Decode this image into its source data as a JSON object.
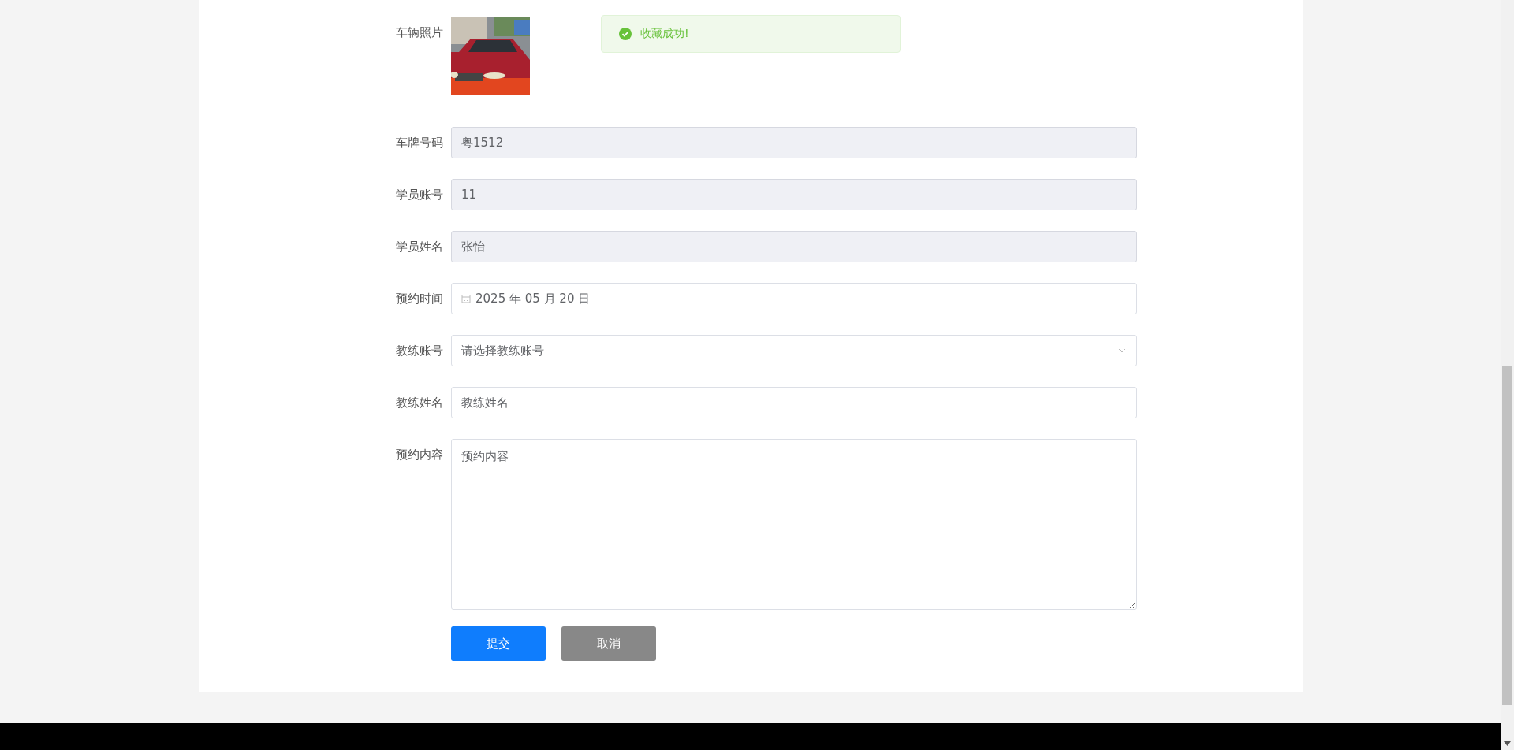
{
  "toast": {
    "kind": "success",
    "text": "收藏成功!"
  },
  "photo": {
    "label": "车辆照片",
    "kind": "picture"
  },
  "fields": [
    {
      "kind": "text",
      "label": "车牌号码",
      "value": "粤1512",
      "readonly": true
    },
    {
      "kind": "text",
      "label": "学员账号",
      "value": "11",
      "readonly": true
    },
    {
      "kind": "text",
      "label": "学员姓名",
      "value": "张怡",
      "readonly": true
    },
    {
      "kind": "date",
      "label": "预约时间",
      "value": "2025 年 05 月 20 日",
      "readonly": false
    },
    {
      "kind": "select",
      "label": "教练账号",
      "placeholder": "请选择教练账号",
      "readonly": false
    },
    {
      "kind": "text",
      "label": "教练姓名",
      "placeholder": "教练姓名",
      "readonly": false
    },
    {
      "kind": "textarea",
      "label": "预约内容",
      "placeholder": "预约内容",
      "readonly": false
    }
  ],
  "buttons": [
    {
      "kind": "primary",
      "label": "提交"
    },
    {
      "kind": "secondary",
      "label": "取消"
    }
  ]
}
